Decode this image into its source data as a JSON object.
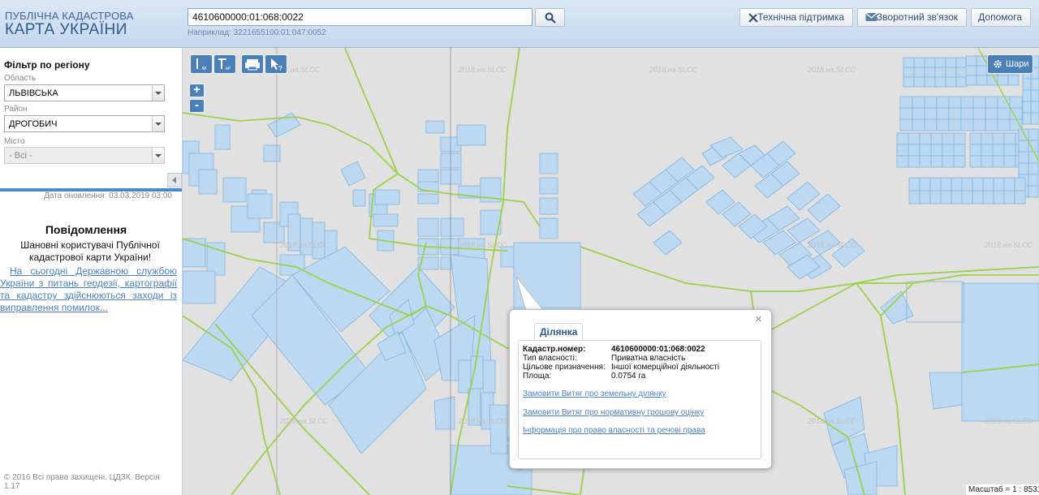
{
  "header": {
    "logo_line1": "ПУБЛІЧНА КАДАСТРОВА",
    "logo_line2": "КАРТА УКРАЇНИ",
    "search_value": "4610600000:01:068:0022",
    "search_example": "Наприклад: 3221655100:01:047:0052",
    "support_label": "Технічна підтримка",
    "feedback_label": "Зворотний зв'язок",
    "help_label": "Допомога"
  },
  "sidebar": {
    "filter_title": "Фільтр по регіону",
    "region_label": "Область",
    "region_value": "ЛЬВІВСЬКА",
    "district_label": "Район",
    "district_value": "ДРОГОБИЧ",
    "city_label": "Місто",
    "city_value": "- Всі -",
    "updated": "Дата оновлення: 03.03.2019 03:00",
    "notif_title": "Повідомлення",
    "notif_text": "Шановні користувачі Публічної кадастрової карти України!",
    "notif_link": "На сьогодні Державною службою України з питань геодезії, картографії та кадастру здійснюються заходи із виправлення помилок...",
    "copyright": "© 2016 Всі права захищені. ЦДЗК. Версія 1.17"
  },
  "map": {
    "layers_label": "Шари",
    "scale": "Масштаб = 1 : 8531",
    "watermark": "2018.на.SLCC",
    "zoom_in": "+",
    "zoom_out": "-"
  },
  "popup": {
    "tab": "Ділянка",
    "close": "×",
    "rows": [
      {
        "k": "Кадастр.номер:",
        "v": "4610600000:01:068:0022"
      },
      {
        "k": "Тип власності:",
        "v": "Приватна власність"
      },
      {
        "k": "Цільове призначення:",
        "v": "Іншої комерційної діяльності"
      },
      {
        "k": "Площа:",
        "v": "0.0754 га"
      }
    ],
    "links": [
      "Замовити Витяг про земельну ділянку",
      "Замовити Витяг про нормативну грошову оцінку",
      "Інформація про право власності та речові права"
    ]
  },
  "colors": {
    "parcel_fill": "#bcd9f1",
    "parcel_stroke": "#7fb3e0",
    "boundary": "#9bd14a",
    "accent": "#4a7fb8"
  }
}
